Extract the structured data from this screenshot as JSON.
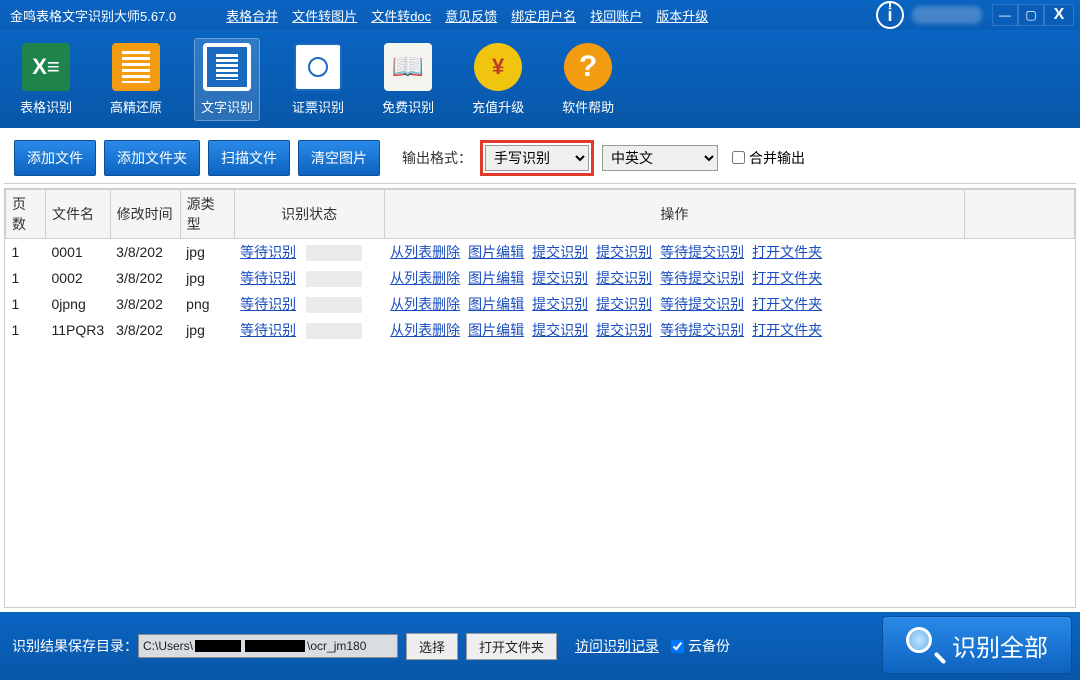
{
  "title": "金鸣表格文字识别大师5.67.0",
  "menu": [
    "表格合并",
    "文件转图片",
    "文件转doc",
    "意见反馈",
    "绑定用户名",
    "找回账户",
    "版本升级"
  ],
  "win": {
    "min": "—",
    "max": "▢",
    "close": "X"
  },
  "ribbon": [
    {
      "label": "表格识别"
    },
    {
      "label": "高精还原"
    },
    {
      "label": "文字识别"
    },
    {
      "label": "证票识别"
    },
    {
      "label": "免费识别"
    },
    {
      "label": "充值升级"
    },
    {
      "label": "软件帮助"
    }
  ],
  "toolbar": {
    "add_file": "添加文件",
    "add_folder": "添加文件夹",
    "scan_file": "扫描文件",
    "clear_images": "清空图片",
    "output_label": "输出格式：",
    "format_selected": "手写识别",
    "lang_selected": "中英文",
    "merge_label": "合并输出"
  },
  "columns": {
    "pages": "页数",
    "filename": "文件名",
    "mtime": "修改时间",
    "srctype": "源类型",
    "status": "识别状态",
    "ops": "操作"
  },
  "rows": [
    {
      "pages": "1",
      "filename": "0001",
      "mtime": "3/8/202",
      "srctype": "jpg"
    },
    {
      "pages": "1",
      "filename": "0002",
      "mtime": "3/8/202",
      "srctype": "jpg"
    },
    {
      "pages": "1",
      "filename": "0jpng",
      "mtime": "3/8/202",
      "srctype": "png"
    },
    {
      "pages": "1",
      "filename": "11PQR3",
      "mtime": "3/8/202",
      "srctype": "jpg"
    }
  ],
  "row_links": {
    "status": "等待识别",
    "ops": [
      "从列表删除",
      "图片编辑",
      "提交识别",
      "提交识别",
      "等待提交识别",
      "打开文件夹"
    ]
  },
  "footer": {
    "save_dir_label": "识别结果保存目录：",
    "path_prefix": "C:\\Users\\",
    "path_suffix": "\\ocr_jm180",
    "choose": "选择",
    "open_folder": "打开文件夹",
    "visit_log": "访问识别记录",
    "cloud_backup": "云备份",
    "recognize_all": "识别全部"
  }
}
